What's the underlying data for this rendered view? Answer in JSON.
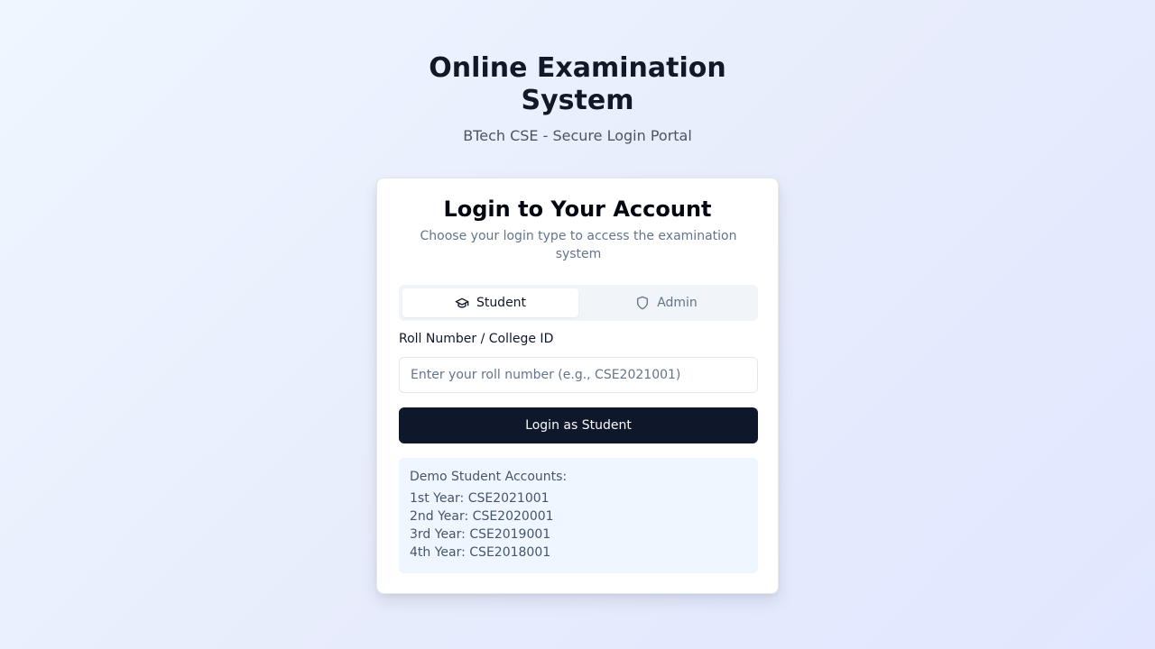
{
  "header": {
    "title": "Online Examination System",
    "subtitle": "BTech CSE - Secure Login Portal"
  },
  "card": {
    "title": "Login to Your Account",
    "description": "Choose your login type to access the examination system"
  },
  "tabs": [
    {
      "label": "Student",
      "icon": "graduation-cap-icon",
      "active": true
    },
    {
      "label": "Admin",
      "icon": "shield-icon",
      "active": false
    }
  ],
  "form": {
    "label": "Roll Number / College ID",
    "placeholder": "Enter your roll number (e.g., CSE2021001)",
    "value": "",
    "submit_label": "Login as Student"
  },
  "demo": {
    "title": "Demo Student Accounts:",
    "accounts": [
      "1st Year: CSE2021001",
      "2nd Year: CSE2020001",
      "3rd Year: CSE2019001",
      "4th Year: CSE2018001"
    ]
  },
  "colors": {
    "primary_button": "#0f172a",
    "demo_background": "#eff6ff",
    "muted_text": "#64748b"
  }
}
